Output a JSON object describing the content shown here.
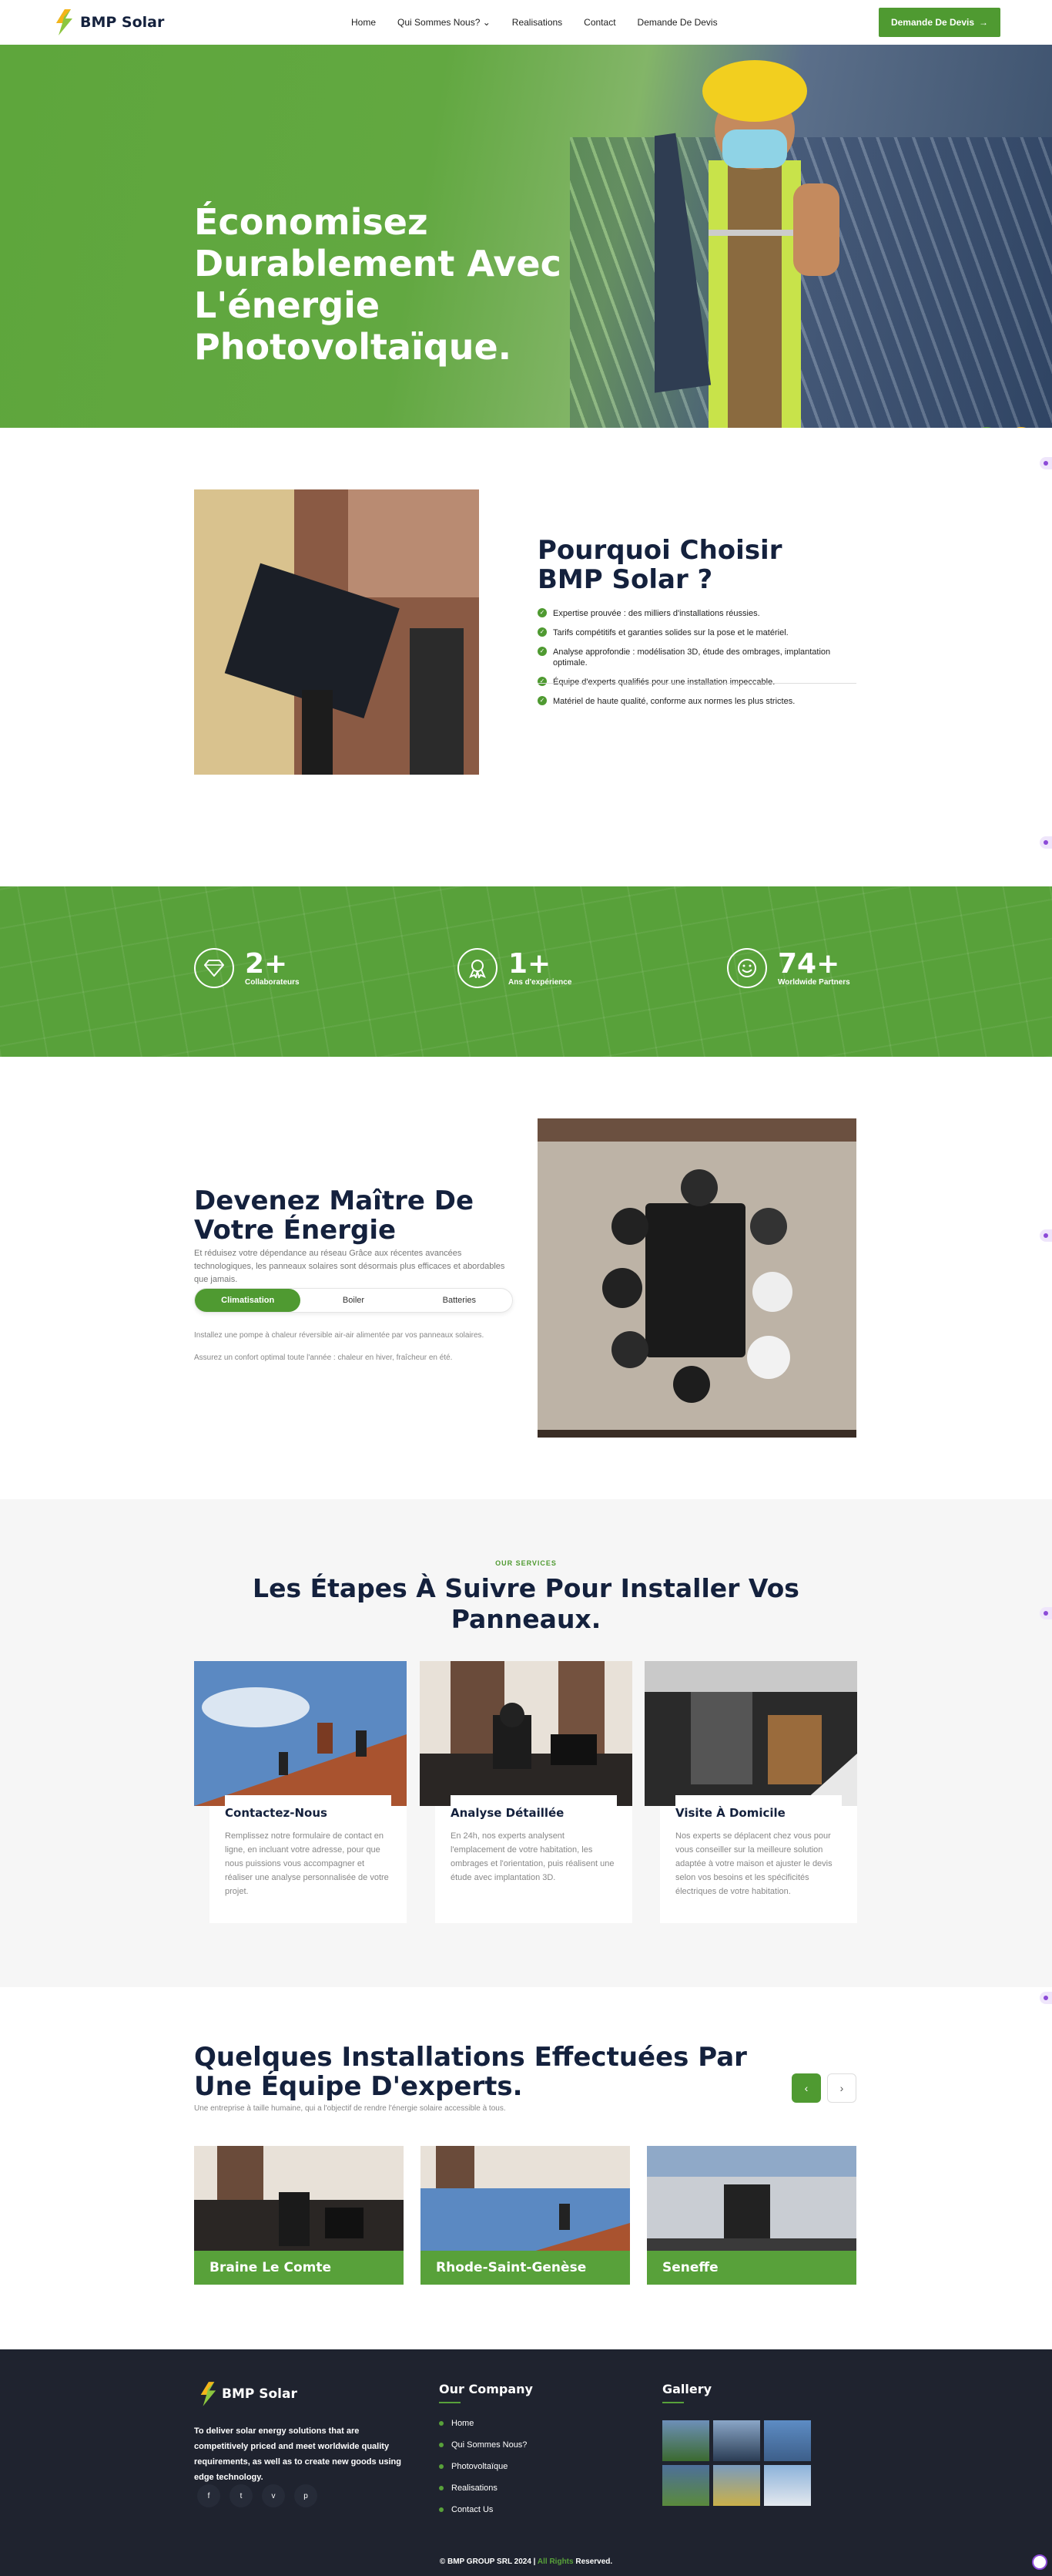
{
  "nav": {
    "brand": "BMP Solar",
    "items": [
      "Home",
      "Qui Sommes Nous?",
      "Realisations",
      "Contact",
      "Demande De Devis"
    ],
    "cta": "Demande De Devis"
  },
  "hero": {
    "title": "Économisez Durablement Avec L'énergie Photovoltaïque.",
    "next_icon": "chevron-right-icon",
    "prev_icon": "chevron-left-icon"
  },
  "why": {
    "title": "Pourquoi Choisir BMP Solar ?",
    "points": [
      "Expertise prouvée : des milliers d'installations réussies.",
      "Tarifs compétitifs et garanties solides sur la pose et le matériel.",
      "Analyse approfondie : modélisation 3D, étude des ombrages, implantation optimale.",
      "Équipe d'experts qualifiés pour une installation impeccable.",
      "Matériel de haute qualité, conforme aux normes les plus strictes."
    ]
  },
  "stats": [
    {
      "value": "2+",
      "label": "Collaborateurs",
      "icon": "diamond-icon"
    },
    {
      "value": "1+",
      "label": "Ans d'expérience",
      "icon": "award-icon"
    },
    {
      "value": "74+",
      "label": "Worldwide Partners",
      "icon": "smile-icon"
    }
  ],
  "energy": {
    "title": "Devenez Maître De Votre Énergie",
    "description": "Et réduisez votre dépendance au réseau Grâce aux récentes avancées technologiques, les panneaux solaires sont désormais plus efficaces et abordables que jamais.",
    "tabs": [
      "Climatisation",
      "Boiler",
      "Batteries"
    ],
    "active_tab": "Climatisation",
    "tab_text_1": "Installez une pompe à chaleur réversible air-air alimentée par vos panneaux solaires.",
    "tab_text_2": "Assurez un confort optimal toute l'année : chaleur en hiver, fraîcheur en été."
  },
  "steps": {
    "tag": "OUR SERVICES",
    "title": "Les Étapes À Suivre Pour Installer Vos Panneaux.",
    "cards": [
      {
        "title": "Contactez-Nous",
        "text": "Remplissez notre formulaire de contact en ligne, en incluant votre adresse, pour que nous puissions vous accompagner et réaliser une analyse personnalisée de votre projet."
      },
      {
        "title": "Analyse Détaillée",
        "text": "En 24h, nos experts analysent l'emplacement de votre habitation, les ombrages et l'orientation, puis réalisent une étude avec implantation 3D."
      },
      {
        "title": "Visite À Domicile",
        "text": "Nos experts se déplacent chez vous pour vous conseiller sur la meilleure solution adaptée à votre maison et ajuster le devis selon vos besoins et les spécificités électriques de votre habitation."
      }
    ]
  },
  "installations": {
    "title": "Quelques Installations Effectuées Par Une Équipe D'experts.",
    "subtitle": "Une entreprise à taille humaine, qui a l'objectif de rendre l'énergie solaire accessible à tous.",
    "items": [
      "Braine Le Comte",
      "Rhode-Saint-Genèse",
      "Seneffe"
    ]
  },
  "footer": {
    "brand": "BMP Solar",
    "about": "To deliver solar energy solutions that are competitively priced and meet worldwide quality requirements, as well as to create new goods using edge technology.",
    "company_heading": "Our Company",
    "company_links": [
      "Home",
      "Qui Sommes Nous?",
      "Photovoltaïque",
      "Realisations",
      "Contact Us"
    ],
    "gallery_heading": "Gallery",
    "social": [
      "f",
      "t",
      "v",
      "p"
    ],
    "copy_main": "© BMP GROUP SRL 2024 |",
    "copy_rights": "All Rights",
    "copy_end": "Reserved."
  }
}
